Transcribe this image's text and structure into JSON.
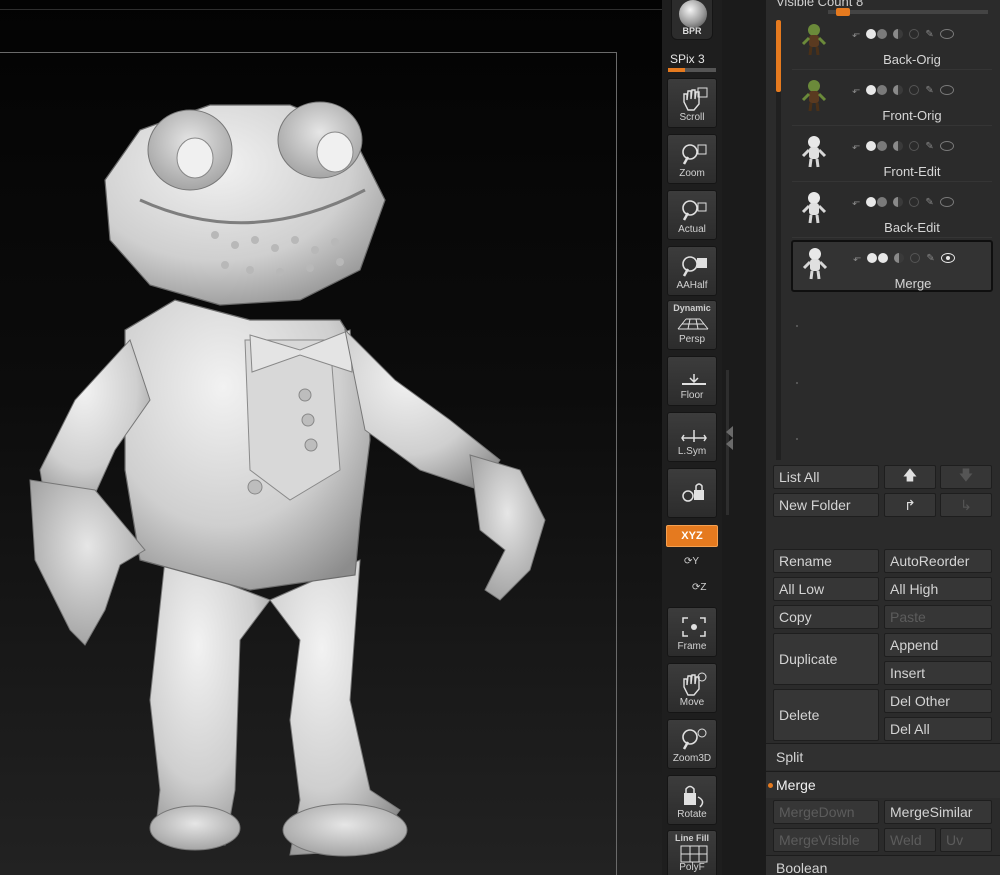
{
  "shelf": {
    "bpr_label": "BPR",
    "spix_label": "SPix 3",
    "spix_fraction": 0.35,
    "buttons": [
      {
        "name": "scroll",
        "label": "Scroll",
        "icon": "hand-scroll-icon"
      },
      {
        "name": "zoom",
        "label": "Zoom",
        "icon": "magnifier-zoom-icon"
      },
      {
        "name": "actual",
        "label": "Actual",
        "icon": "magnifier-actual-icon"
      },
      {
        "name": "aahalf",
        "label": "AAHalf",
        "icon": "magnifier-aahalf-icon"
      },
      {
        "name": "persp",
        "label": "Persp",
        "top": "Dynamic",
        "icon": "perspective-grid-icon"
      },
      {
        "name": "floor",
        "label": "Floor",
        "icon": "floor-icon"
      },
      {
        "name": "lsym",
        "label": "L.Sym",
        "icon": "local-symmetry-icon"
      },
      {
        "name": "lock",
        "label": "",
        "icon": "camera-lock-icon"
      },
      {
        "name": "frame",
        "label": "Frame",
        "icon": "frame-icon"
      },
      {
        "name": "move",
        "label": "Move",
        "icon": "hand-move-icon"
      },
      {
        "name": "zoom3d",
        "label": "Zoom3D",
        "icon": "magnifier-zoom3d-icon"
      },
      {
        "name": "rotate",
        "label": "Rotate",
        "icon": "rotate-icon"
      },
      {
        "name": "polyf",
        "label": "PolyF",
        "top": "Line Fill",
        "icon": "polyframe-grid-icon"
      }
    ],
    "xyz_label": "XYZ",
    "y_label": "Y",
    "z_label": "Z"
  },
  "panel": {
    "visible_count": "Visible Count 8",
    "subtools": [
      {
        "name": "Back-Orig",
        "selected": false
      },
      {
        "name": "Front-Orig",
        "selected": false
      },
      {
        "name": "Front-Edit",
        "selected": false
      },
      {
        "name": "Back-Edit",
        "selected": false
      },
      {
        "name": "Merge",
        "selected": true
      }
    ],
    "buttons": {
      "list_all": "List All",
      "new_folder": "New Folder",
      "rename": "Rename",
      "auto_reorder": "AutoReorder",
      "all_low": "All Low",
      "all_high": "All High",
      "copy": "Copy",
      "paste": "Paste",
      "duplicate": "Duplicate",
      "append": "Append",
      "insert": "Insert",
      "delete": "Delete",
      "del_other": "Del Other",
      "del_all": "Del All"
    },
    "sections": {
      "split": "Split",
      "merge": "Merge",
      "boolean": "Boolean"
    },
    "merge_buttons": {
      "merge_down": "MergeDown",
      "merge_similar": "MergeSimilar",
      "merge_visible": "MergeVisible",
      "weld": "Weld",
      "uv": "Uv"
    }
  },
  "colors": {
    "accent": "#e57a1f",
    "panel_bg": "#2b2b2b",
    "button_bg": "#363636"
  }
}
